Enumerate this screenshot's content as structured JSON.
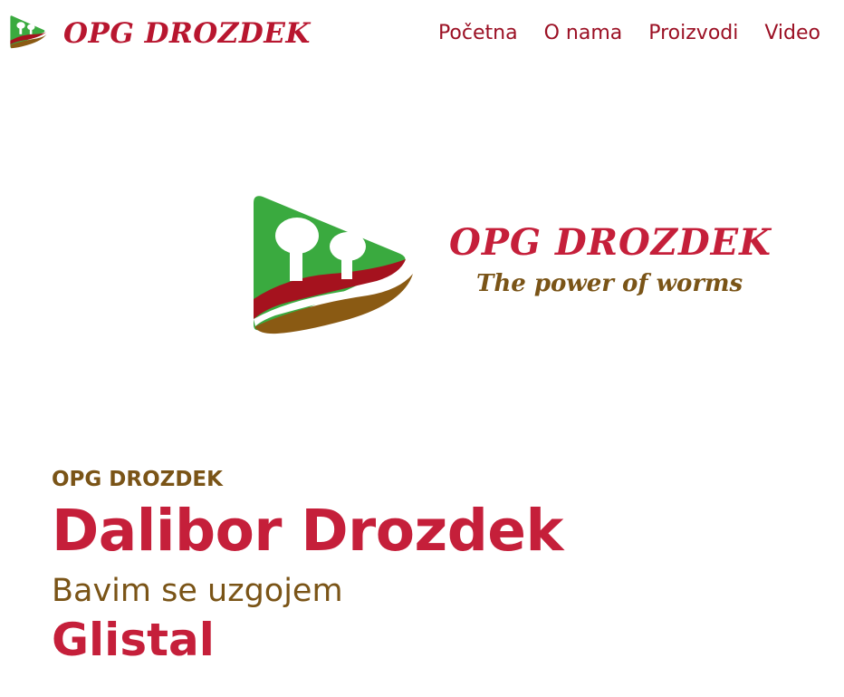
{
  "header": {
    "brand_name": "OPG DROZDEK",
    "logo_icon": "mushroom-play-logo-icon",
    "nav": [
      {
        "label": "Početna"
      },
      {
        "label": "O nama"
      },
      {
        "label": "Proizvodi"
      },
      {
        "label": "Video"
      }
    ]
  },
  "hero": {
    "logo_icon": "mushroom-play-logo-icon",
    "title": "OPG DROZDEK",
    "tagline": "The power of worms"
  },
  "intro": {
    "kicker": "OPG DROZDEK",
    "name": "Dalibor Drozdek",
    "lead": "Bavim se uzgojem",
    "product": "Glistal"
  },
  "colors": {
    "brand_red": "#c51f3a",
    "nav_red": "#9b1024",
    "brown": "#7a5417",
    "green": "#3aaa3f"
  }
}
